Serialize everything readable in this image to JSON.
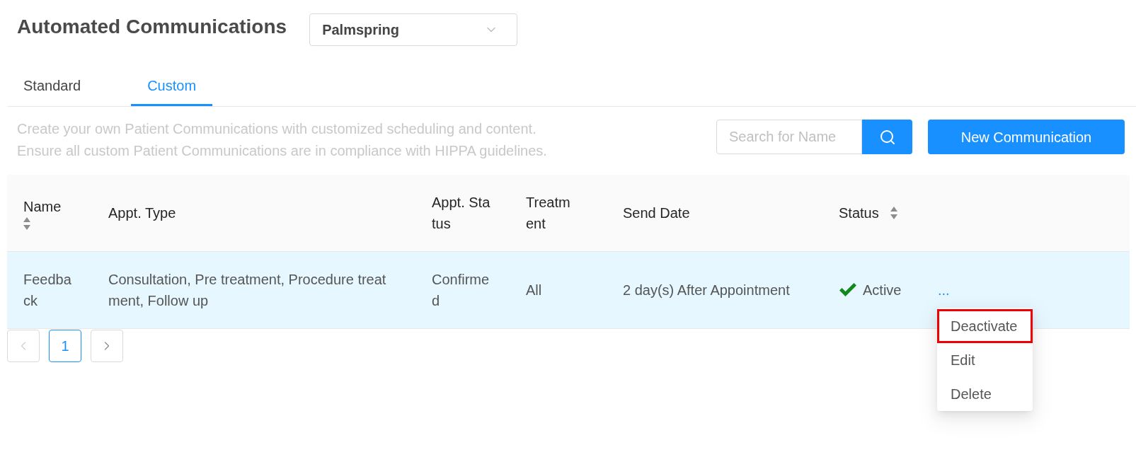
{
  "header": {
    "title": "Automated Communications",
    "location_select": {
      "value": "Palmspring"
    }
  },
  "tabs": [
    {
      "label": "Standard",
      "selected": false
    },
    {
      "label": "Custom",
      "selected": true
    }
  ],
  "description": [
    "Create your own Patient Communications with customized scheduling and content.",
    "Ensure all custom Patient Communications are in compliance with HIPPA guidelines."
  ],
  "search": {
    "placeholder": "Search for Name"
  },
  "new_button": {
    "label": "New Communication"
  },
  "table": {
    "columns": [
      {
        "label": "Name",
        "sortable": true
      },
      {
        "label": "Appt. Type",
        "sortable": false
      },
      {
        "label": "Appt. Status",
        "sortable": false
      },
      {
        "label": "Treatment",
        "sortable": false
      },
      {
        "label": "Send Date",
        "sortable": false
      },
      {
        "label": "Status",
        "sortable": true
      }
    ],
    "rows": [
      {
        "selected": true,
        "cells": [
          "Feedback",
          "Consultation, Pre treatment, Procedure treatment, Follow up",
          "Confirmed",
          "All",
          "2 day(s) After Appointment"
        ],
        "status": {
          "label": "Active",
          "kind": "active"
        },
        "actions": {
          "label": "...",
          "menu": [
            {
              "label": "Deactivate",
              "highlighted": true
            },
            {
              "label": "Edit",
              "highlighted": false
            },
            {
              "label": "Delete",
              "highlighted": false
            }
          ]
        }
      }
    ]
  },
  "pagination": {
    "prev": {
      "disabled": true
    },
    "pages": [
      {
        "label": "1",
        "selected": true
      }
    ],
    "next": {
      "disabled": false
    }
  }
}
